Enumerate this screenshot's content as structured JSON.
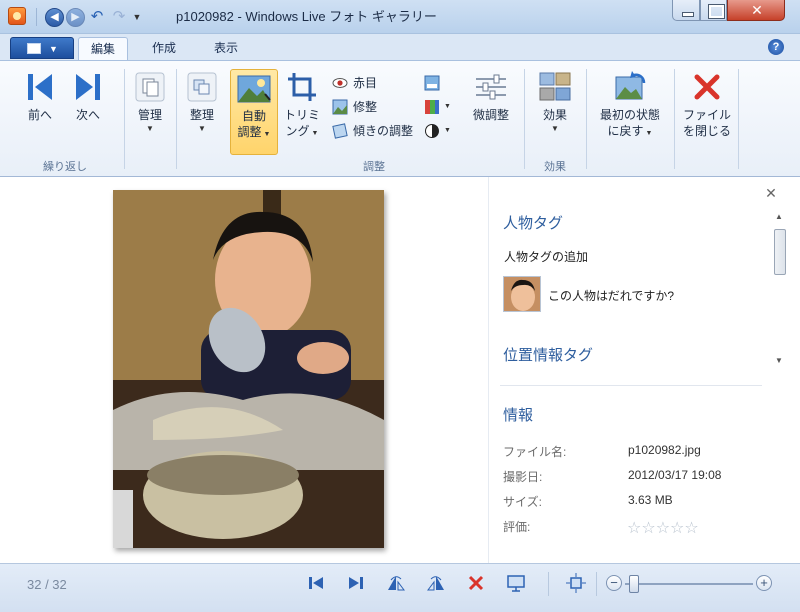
{
  "window": {
    "title": "p1020982 - Windows Live フォト ギャラリー"
  },
  "quick_access": {
    "icons": [
      "back-icon",
      "forward-icon",
      "undo-icon",
      "redo-icon",
      "customize-dropdown-icon"
    ]
  },
  "ribbon": {
    "tabs": [
      {
        "label": "編集",
        "active": true
      },
      {
        "label": "作成",
        "active": false
      },
      {
        "label": "表示",
        "active": false
      }
    ],
    "groups": {
      "navigate": {
        "label": "繰り返し",
        "prev_label": "前へ",
        "next_label": "次へ"
      },
      "manage": {
        "label": "管理"
      },
      "organize": {
        "label": "整理"
      },
      "adjust": {
        "label": "調整",
        "auto_adjust_line1": "自動",
        "auto_adjust_line2": "調整",
        "crop_line1": "トリミ",
        "crop_line2": "ング",
        "red_eye": "赤目",
        "retouch": "修整",
        "straighten": "傾きの調整",
        "fine_tune": "微調整"
      },
      "effects": {
        "label": "効果",
        "button": "効果"
      },
      "revert": {
        "line1": "最初の状態",
        "line2": "に戻す"
      },
      "close": {
        "line1": "ファイル",
        "line2": "を閉じる"
      }
    },
    "accent_pressed": "#ffd46b"
  },
  "info_pane": {
    "people_tags": {
      "heading": "人物タグ",
      "add_link": "人物タグの追加",
      "who_prompt": "この人物はだれですか?"
    },
    "geotag": {
      "heading": "位置情報タグ"
    },
    "info": {
      "heading": "情報",
      "rows": [
        {
          "key": "ファイル名:",
          "value": "p1020982.jpg"
        },
        {
          "key": "撮影日:",
          "value": "2012/03/17  19:08"
        },
        {
          "key": "サイズ:",
          "value": "3.63 MB"
        },
        {
          "key": "評価:",
          "value": ""
        }
      ],
      "rating_stars": "☆☆☆☆☆",
      "rating": 0
    },
    "heading_color": "#2e5e9e"
  },
  "statusbar": {
    "counter": "32 / 32",
    "icons": [
      "previous-icon",
      "next-icon",
      "rotate-left-icon",
      "rotate-right-icon",
      "delete-icon",
      "slideshow-icon",
      "actual-size-icon"
    ],
    "zoom_level": 0.03
  }
}
